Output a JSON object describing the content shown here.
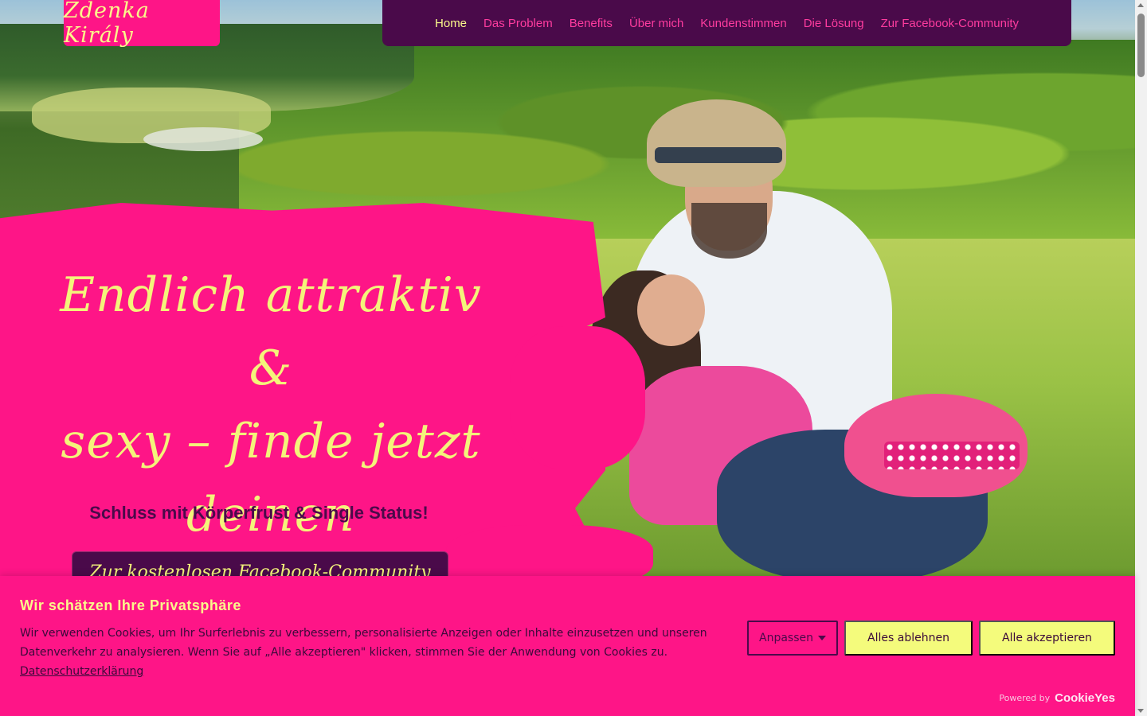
{
  "brand": {
    "logo_text": "Zdenka Király"
  },
  "nav": {
    "items": [
      {
        "label": "Home",
        "active": true
      },
      {
        "label": "Das Problem",
        "active": false
      },
      {
        "label": "Benefits",
        "active": false
      },
      {
        "label": "Über mich",
        "active": false
      },
      {
        "label": "Kundenstimmen",
        "active": false
      },
      {
        "label": "Die Lösung",
        "active": false
      },
      {
        "label": "Zur Facebook-Community",
        "active": false
      }
    ]
  },
  "hero": {
    "headline_line1": "Endlich attraktiv &",
    "headline_line2": "sexy – finde jetzt",
    "headline_line3": "deinen Traummann!",
    "subline": "Schluss mit Körperfrust & Single Status!",
    "cta_label": "Zur kostenlosen Facebook-Community"
  },
  "cookie_banner": {
    "title": "Wir schätzen Ihre Privatsphäre",
    "text": "Wir verwenden Cookies, um Ihr Surferlebnis zu verbessern, personalisierte Anzeigen oder Inhalte einzusetzen und unseren Datenverkehr zu analysieren. Wenn Sie auf „Alle akzeptieren\" klicken, stimmen Sie der Anwendung von Cookies zu.",
    "privacy_link": "Datenschutzerklärung",
    "customize_label": "Anpassen",
    "reject_label": "Alles ablehnen",
    "accept_label": "Alle akzeptieren",
    "powered_by": "Powered by",
    "powered_brand": "CookieYes"
  },
  "colors": {
    "pink": "#fe1587",
    "purple": "#4a0a4a",
    "yellow": "#fbf98b"
  }
}
